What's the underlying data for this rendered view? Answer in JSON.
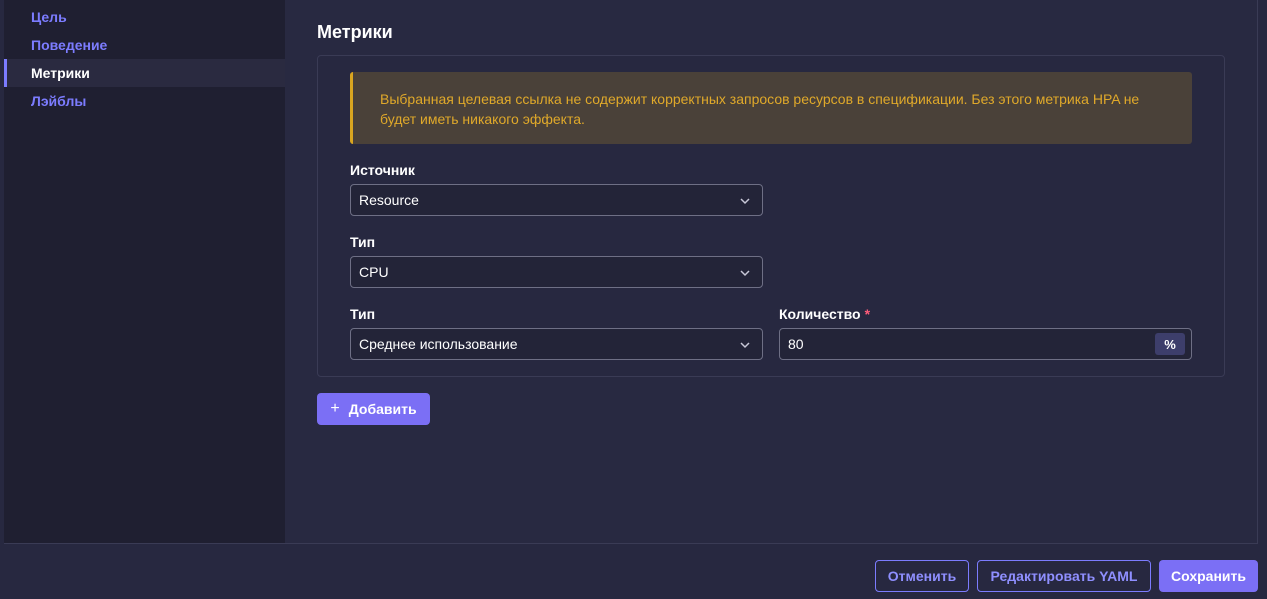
{
  "sidebar": {
    "items": [
      {
        "label": "Цель"
      },
      {
        "label": "Поведение"
      },
      {
        "label": "Метрики"
      },
      {
        "label": "Лэйблы"
      }
    ]
  },
  "main": {
    "title": "Метрики",
    "warning": "Выбранная целевая ссылка не содержит корректных запросов ресурсов в спецификации. Без этого метрика HPA не будет иметь никакого эффекта.",
    "source": {
      "label": "Источник",
      "value": "Resource"
    },
    "type1": {
      "label": "Тип",
      "value": "CPU"
    },
    "type2": {
      "label": "Тип",
      "value": "Среднее использование"
    },
    "quantity": {
      "label": "Количество",
      "required_mark": "*",
      "value": "80",
      "suffix": "%"
    },
    "add_button": {
      "icon": "+",
      "label": "Добавить"
    }
  },
  "footer": {
    "cancel_label": "Отменить",
    "edit_yaml_label": "Редактировать YAML",
    "save_label": "Сохранить"
  },
  "colors": {
    "accent": "#7b6ff5",
    "warning_text": "#e0a92a",
    "warning_bg": "#4a4139"
  }
}
